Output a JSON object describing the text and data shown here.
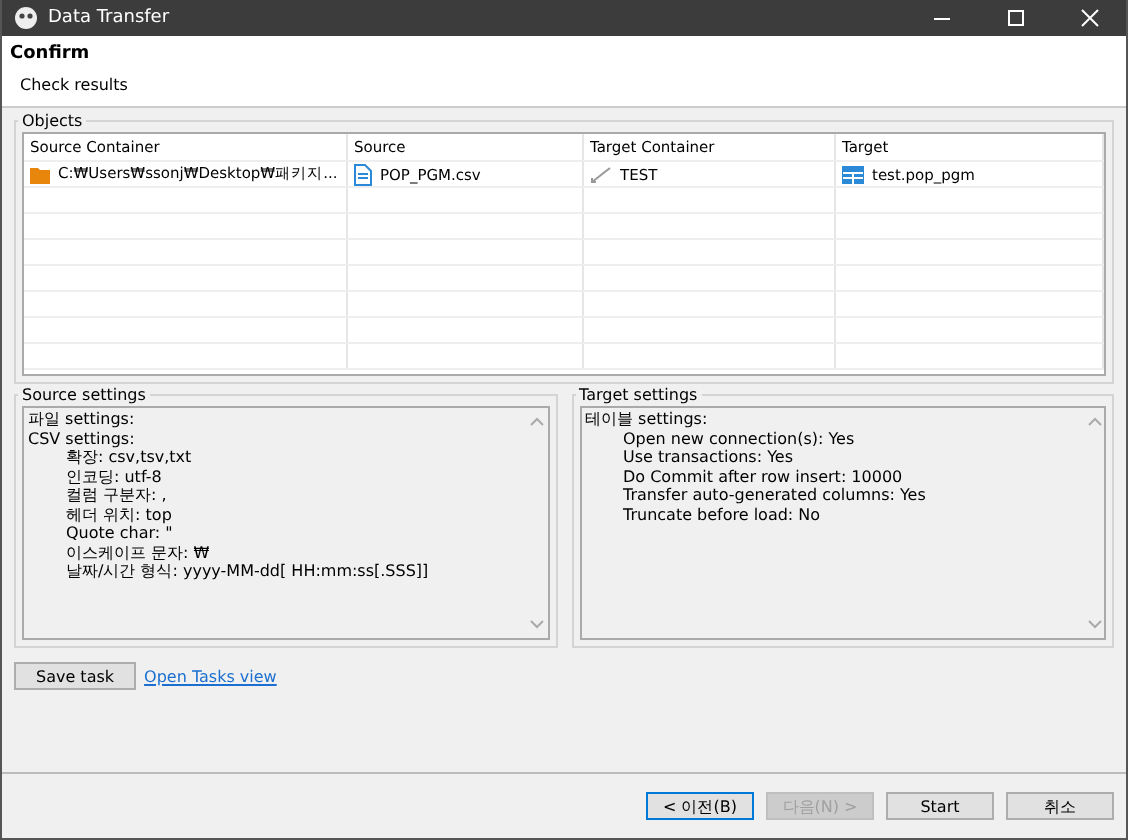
{
  "window": {
    "title": "Data Transfer"
  },
  "header": {
    "title": "Confirm",
    "subtitle": "Check results"
  },
  "objects": {
    "label": "Objects",
    "columns": [
      "Source Container",
      "Source",
      "Target Container",
      "Target"
    ],
    "rows": [
      {
        "source_container": "C:₩Users₩ssonj₩Desktop₩패키지...",
        "source": "POP_PGM.csv",
        "target_container": "TEST",
        "target": "test.pop_pgm"
      }
    ]
  },
  "source_settings": {
    "label": "Source settings",
    "lines": [
      {
        "text": "파일 settings:"
      },
      {
        "text": "CSV settings:",
        "children": [
          "확장: csv,tsv,txt",
          "인코딩: utf-8",
          "컬럼 구분자: ,",
          "헤더 위치: top",
          "Quote char: \"",
          "이스케이프 문자: ₩",
          "날짜/시간 형식: yyyy-MM-dd[ HH:mm:ss[.SSS]]"
        ]
      }
    ]
  },
  "target_settings": {
    "label": "Target settings",
    "lines": [
      {
        "text": "테이블 settings:",
        "children": [
          "Open new connection(s): Yes",
          "Use transactions: Yes",
          "Do Commit after row insert: 10000",
          "Transfer auto-generated columns: Yes",
          "Truncate before load: No"
        ]
      }
    ]
  },
  "save_task": "Save task",
  "open_tasks_link": "Open Tasks view",
  "buttons": [
    {
      "label": "< 이전(B)",
      "disabled": false,
      "selected": true
    },
    {
      "label": "다음(N) >",
      "disabled": true,
      "selected": false
    },
    {
      "label": "Start",
      "disabled": false,
      "selected": false
    },
    {
      "label": "취소",
      "disabled": false,
      "selected": false
    }
  ]
}
